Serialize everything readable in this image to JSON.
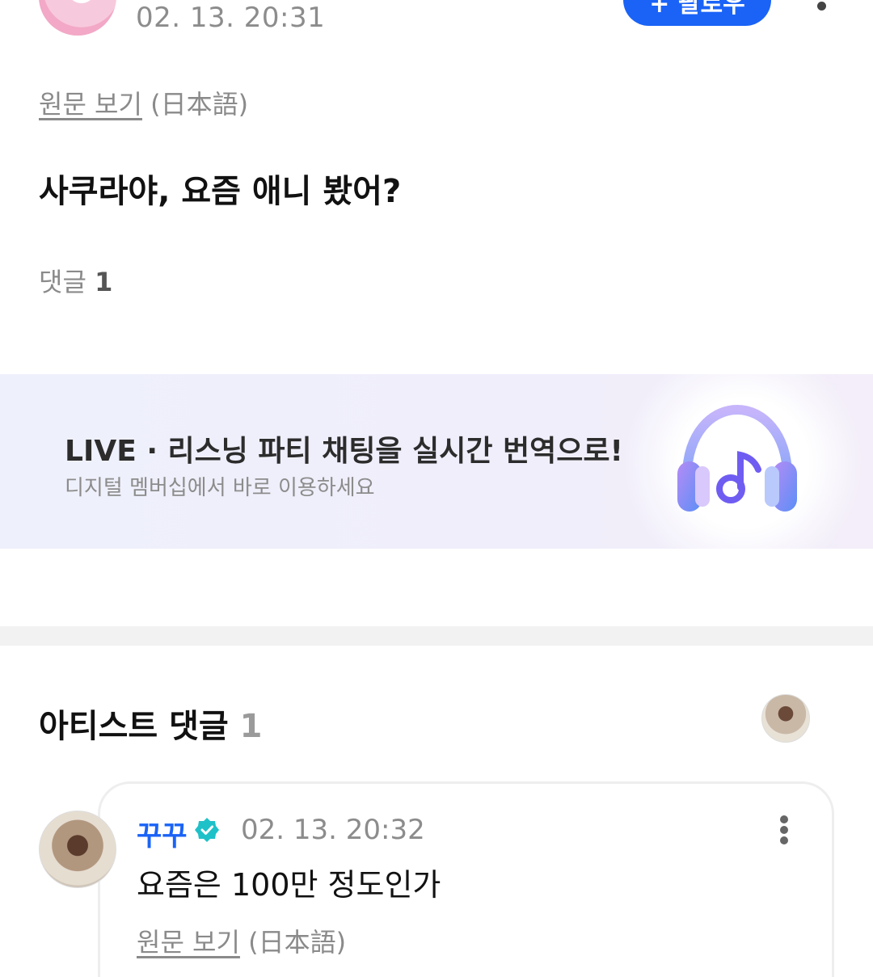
{
  "post": {
    "date": "02. 13. 20:31",
    "follow_label": "+ 팔로우",
    "original_link": "원문 보기",
    "original_lang": "(日本語)",
    "body": "사쿠라야, 요즘 애니 봤어?",
    "comment_label": "댓글",
    "comment_count": "1"
  },
  "banner": {
    "title": "LIVE · 리스닝 파티 채팅을 실시간 번역으로!",
    "subtitle": "디지털 멤버십에서 바로 이용하세요",
    "icon": "headphones-music-icon"
  },
  "artist_comments": {
    "title": "아티스트 댓글",
    "count": "1",
    "items": [
      {
        "name": "꾸꾸",
        "verified_icon": "verified-badge-icon",
        "date": "02. 13. 20:32",
        "body": "요즘은 100만 정도인가",
        "original_link": "원문 보기",
        "original_lang": "(日本語)"
      }
    ]
  },
  "colors": {
    "accent": "#1a63f6",
    "verified": "#1fc1c8"
  }
}
